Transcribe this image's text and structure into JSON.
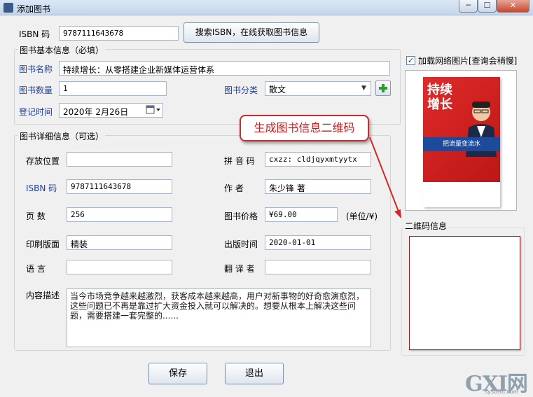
{
  "window": {
    "title": "添加图书",
    "min_label": "─",
    "max_label": "☐",
    "close_label": "✕"
  },
  "top": {
    "isbn_label": "ISBN  码",
    "isbn_value": "9787111643678",
    "search_button": "搜索ISBN，在线获取图书信息"
  },
  "basic": {
    "group_title": "图书基本信息（必填）",
    "name_label": "图书名称",
    "name_value": "持续增长：从零搭建企业新媒体运营体系",
    "qty_label": "图书数量",
    "qty_value": "1",
    "category_label": "图书分类",
    "category_value": "散文",
    "date_label": "登记时间",
    "date_value": "2020年 2月26日"
  },
  "detail": {
    "group_title": "图书详细信息（可选）",
    "location_label": "存放位置",
    "location_value": "",
    "pinyin_label": "拼 音 码",
    "pinyin_value": "cxzz: cldjqyxmtyytx",
    "isbn_label": "ISBN  码",
    "isbn_value": "9787111643678",
    "author_label": "作    者",
    "author_value": "朱少锋 著",
    "pages_label": "页    数",
    "pages_value": "256",
    "price_label": "图书价格",
    "price_value": "¥69.00",
    "price_unit": "(单位/¥)",
    "format_label": "印刷版面",
    "format_value": "精装",
    "pubdate_label": "出版时间",
    "pubdate_value": "2020-01-01",
    "language_label": "语    言",
    "language_value": "",
    "translator_label": "翻 译 者",
    "translator_value": "",
    "desc_label": "内容描述",
    "desc_value": "当今市场竞争越来越激烈，获客成本越来越高，用户对新事物的好奇愈演愈烈，这些问题已不再是靠过扩大资金投入就可以解决的。想要从根本上解决这些问题，需要搭建一套完整的......"
  },
  "right": {
    "load_image_label": "加载网络图片[查询会稍慢]",
    "load_image_checked": "✓",
    "qr_group_title": "二维码信息",
    "cover_title": "持续增长",
    "cover_band": "把流量变流水"
  },
  "callout": {
    "text": "生成图书信息二维码"
  },
  "buttons": {
    "save": "保存",
    "exit": "退出"
  },
  "watermark": {
    "main": "GXI网",
    "sub": "system.com"
  },
  "colors": {
    "label_blue": "#1d3f9b",
    "callout_red": "#cc2b2b"
  }
}
